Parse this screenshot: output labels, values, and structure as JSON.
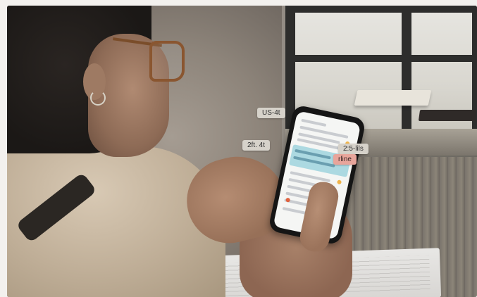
{
  "overlay_labels": {
    "top": "US-4t",
    "left": "2ft. 4t",
    "right": "2:5-lils",
    "pink": "rline"
  }
}
